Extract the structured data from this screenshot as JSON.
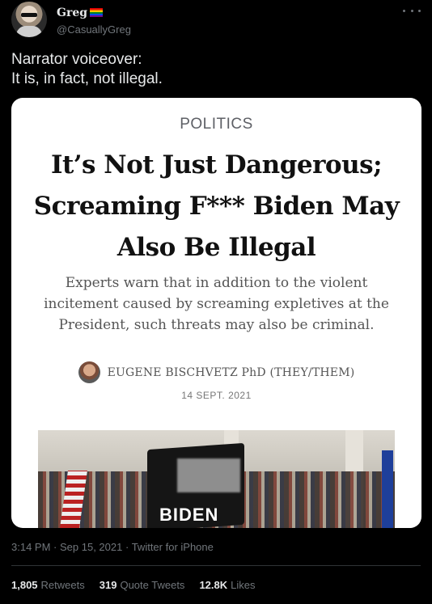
{
  "user": {
    "display_name": "Greg",
    "handle": "@CasuallyGreg",
    "name_emoji": "rainbow-flag-icon"
  },
  "tweet": {
    "lines": [
      "Narrator voiceover:",
      "It is, in fact, not illegal."
    ]
  },
  "card": {
    "kicker": "POLITICS",
    "headline": "It’s Not Just Dangerous; Screaming F*** Biden May Also Be Illegal",
    "dek": "Experts warn that in addition to the violent incitement caused by screaming expletives at the President, such threats may also be criminal.",
    "byline": "EUGENE BISCHVETZ PhD (THEY/THEM)",
    "date": "14 SEPT. 2021",
    "photo_text": "BIDEN"
  },
  "meta": {
    "time": "3:14 PM",
    "date": "Sep 15, 2021",
    "source": "Twitter for iPhone"
  },
  "stats": {
    "retweets_count": "1,805",
    "retweets_label": "Retweets",
    "quotes_count": "319",
    "quotes_label": "Quote Tweets",
    "likes_count": "12.8K",
    "likes_label": "Likes"
  },
  "colors": {
    "background": "#000000",
    "text": "#e7e9ea",
    "secondary": "#71767b",
    "card": "#ffffff"
  }
}
